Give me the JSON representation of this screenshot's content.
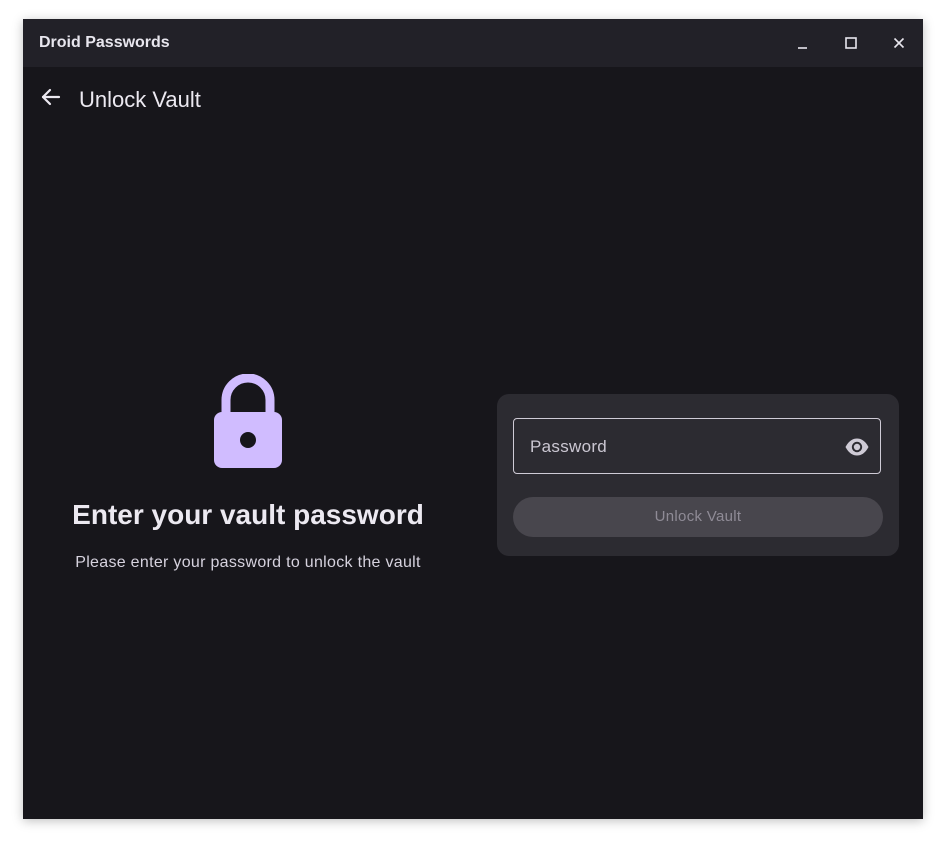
{
  "window": {
    "title": "Droid Passwords"
  },
  "appbar": {
    "title": "Unlock Vault"
  },
  "intro": {
    "heading": "Enter your vault password",
    "subtitle": "Please enter your password to unlock the vault"
  },
  "form": {
    "password_placeholder": "Password",
    "password_value": "",
    "unlock_label": "Unlock Vault"
  },
  "icons": {
    "back": "arrow-back-icon",
    "lock": "lock-icon",
    "visibility": "eye-icon",
    "minimize": "minimize-icon",
    "maximize": "maximize-icon",
    "close": "close-icon"
  },
  "colors": {
    "background": "#17161b",
    "titlebar": "#222128",
    "card": "#2c2b31",
    "accent_lock": "#d0bcff",
    "button_disabled_bg": "#48464d",
    "button_disabled_text": "#8f8b96"
  }
}
